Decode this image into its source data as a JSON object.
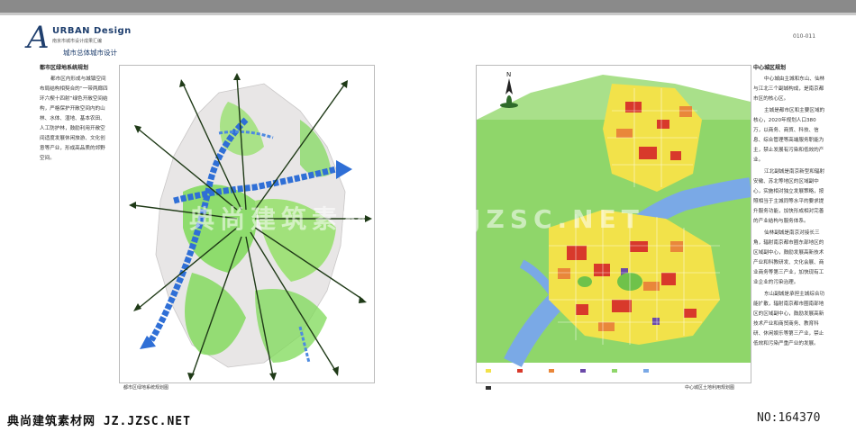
{
  "header": {
    "logo_letter": "A",
    "logo_word": "URBAN Design",
    "logo_subtitle": "南京市城市设计成果汇编",
    "section_title": "城市总体城市设计",
    "page_number": "010-011"
  },
  "left_text": {
    "heading": "都市区绿地系统规划",
    "body": "都市区内形成与城镇空间布局结构相契合的“一带两廊四环六楔十四射”绿色开敞空间结构，严格保护开敞空间内的山林、水体、湿地、基本农田、人工防护林，鼓励利用开敞空间适度发展休闲旅游、文化创意等产业，形成高品质的郊野空间。"
  },
  "right_text": {
    "heading": "中心城区规划",
    "paragraphs": [
      "中心城由主城和东山、仙林与江北三个副城构成，是南京都市区的核心区。",
      "主城是都市区和主要区域的核心，2020年规划人口380万，以商务、商贸、科技、信息、综合管理等高端服务职能为主，禁止发展有污染和低效的产业。",
      "江北副城是南京新型和辐射安徽、苏北等地区的区域副中心，实施相对独立发展策略，按照相当于主城同等水平的要求提升服务功能，加快形成相对完善的产业结构与服务体系。",
      "仙林副城是南京对接长三角，辐射南京都市圈东部地区的区域副中心，鼓励发展高新技术产业和科教研发、文化会展、商业商务等第三产业，加快现有工业企业的污染治理。",
      "东山副城是承担主城综合功能扩散，辐射南京都市圈南部地区的区域副中心，鼓励发展高新技术产业和商贸商务、教育科研、休闲娱乐等第三产业，禁止低效和污染严重产业的发展。"
    ]
  },
  "captions": {
    "left_map": "都市区绿地系统规划图",
    "right_map": "中心城区土地利用规划图"
  },
  "watermark": "典尚建筑素材网  JZ.JZSC.NET",
  "footer": {
    "left": "典尚建筑素材网 JZ.JZSC.NET",
    "right": "NO:164370"
  },
  "map_label": "N",
  "colors": {
    "top_bar": "#8a8a8a",
    "brand_blue": "#1f3f6e",
    "green_space": "#7ed957",
    "river_blue": "#2f6fd6",
    "land_yellow": "#f2e24a",
    "land_red": "#d8392b",
    "land_orange": "#e9873a"
  }
}
